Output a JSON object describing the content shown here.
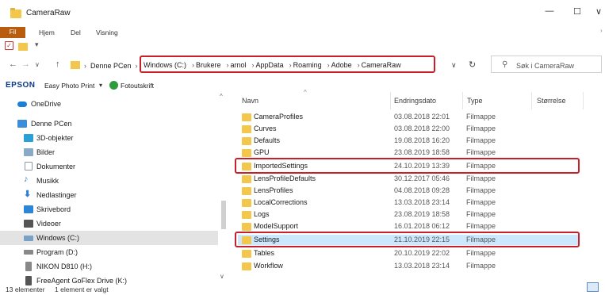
{
  "window": {
    "title": "CameraRaw",
    "minimize_glyph": "—",
    "maximize_glyph": "☐",
    "close_glyph": "✕",
    "chevron_glyph": "∨"
  },
  "ribbon": {
    "tabs": [
      "Fil",
      "Hjem",
      "Del",
      "Visning"
    ]
  },
  "quick_access": {
    "dropdown_glyph": "▾"
  },
  "address": {
    "back_glyph": "←",
    "forward_glyph": "→",
    "recent_glyph": "∨",
    "up_glyph": "↑",
    "prefix": "Denne PCen",
    "crumbs": [
      "Windows (C:)",
      "Brukere",
      "arnol",
      "AppData",
      "Roaming",
      "Adobe",
      "CameraRaw"
    ],
    "separator": "›",
    "dropdown_glyph": "∨",
    "refresh_glyph": "↻",
    "search_placeholder": "Søk i CameraRaw"
  },
  "toolbar": {
    "brand": "EPSON",
    "easy_photo_print": "Easy Photo Print",
    "dropdown_glyph": "▾",
    "fotoutskrift": "Fotoutskrift"
  },
  "nav_pane": {
    "items": [
      {
        "label": "OneDrive",
        "icon": "cloud-icon",
        "color": "#1b7fd8"
      },
      {
        "label": "Denne PCen",
        "icon": "computer-icon",
        "color": "#3b8fd9"
      },
      {
        "label": "3D-objekter",
        "icon": "cube-icon",
        "color": "#2aa0d8"
      },
      {
        "label": "Bilder",
        "icon": "pictures-icon",
        "color": "#8aa8c8"
      },
      {
        "label": "Dokumenter",
        "icon": "document-icon",
        "color": "#8899aa"
      },
      {
        "label": "Musikk",
        "icon": "music-icon",
        "color": "#2b7fd4"
      },
      {
        "label": "Nedlastinger",
        "icon": "download-icon",
        "color": "#2b7fd4"
      },
      {
        "label": "Skrivebord",
        "icon": "desktop-icon",
        "color": "#2b86d8"
      },
      {
        "label": "Videoer",
        "icon": "video-icon",
        "color": "#555555"
      },
      {
        "label": "Windows (C:)",
        "icon": "drive-icon",
        "color": "#7aa0c8",
        "selected": true
      },
      {
        "label": "Program (D:)",
        "icon": "drive-icon",
        "color": "#888888"
      },
      {
        "label": "NIKON D810 (H:)",
        "icon": "usb-drive-icon",
        "color": "#888888"
      },
      {
        "label": "FreeAgent GoFlex Drive (K:)",
        "icon": "usb-drive-icon",
        "color": "#555555"
      }
    ],
    "scroll_up_glyph": "^",
    "scroll_down_glyph": "∨"
  },
  "columns": {
    "name": "Navn",
    "date": "Endringsdato",
    "type": "Type",
    "size": "Størrelse",
    "sort_glyph": "^"
  },
  "files": [
    {
      "name": "CameraProfiles",
      "date": "03.08.2018 22:01",
      "type": "Filmappe"
    },
    {
      "name": "Curves",
      "date": "03.08.2018 22:00",
      "type": "Filmappe"
    },
    {
      "name": "Defaults",
      "date": "19.08.2018 16:20",
      "type": "Filmappe"
    },
    {
      "name": "GPU",
      "date": "23.08.2019 18:58",
      "type": "Filmappe"
    },
    {
      "name": "ImportedSettings",
      "date": "24.10.2019 13:39",
      "type": "Filmappe"
    },
    {
      "name": "LensProfileDefaults",
      "date": "30.12.2017 05:46",
      "type": "Filmappe"
    },
    {
      "name": "LensProfiles",
      "date": "04.08.2018 09:28",
      "type": "Filmappe"
    },
    {
      "name": "LocalCorrections",
      "date": "13.03.2018 23:14",
      "type": "Filmappe"
    },
    {
      "name": "Logs",
      "date": "23.08.2019 18:58",
      "type": "Filmappe"
    },
    {
      "name": "ModelSupport",
      "date": "16.01.2018 06:12",
      "type": "Filmappe"
    },
    {
      "name": "Settings",
      "date": "21.10.2019 22:15",
      "type": "Filmappe",
      "selected": true
    },
    {
      "name": "Tables",
      "date": "20.10.2019 22:02",
      "type": "Filmappe"
    },
    {
      "name": "Workflow",
      "date": "13.03.2018 23:14",
      "type": "Filmappe"
    }
  ],
  "status": {
    "count": "13 elementer",
    "selection": "1 element er valgt"
  },
  "colors": {
    "highlight_red": "#c8202a",
    "selection_blue": "#cce8ff",
    "folder_yellow": "#f3c74b",
    "fil_tab": "#b85c0f"
  }
}
